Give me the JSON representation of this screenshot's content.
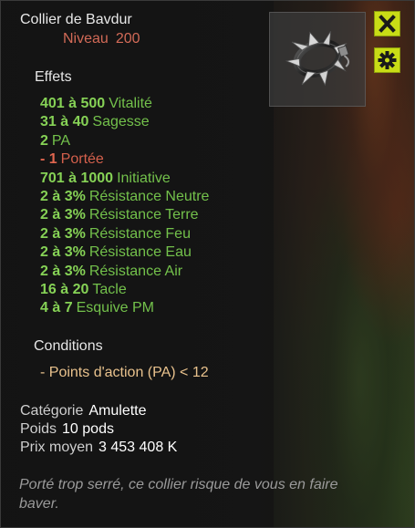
{
  "item": {
    "name": "Collier de Bavdur",
    "level_label": "Niveau",
    "level_value": "200",
    "image_icon": "spiked-collar-icon"
  },
  "buttons": {
    "close_icon": "close-icon",
    "settings_icon": "gear-icon",
    "accent_color": "#c9dc16"
  },
  "effects": {
    "heading": "Effets",
    "items": [
      {
        "value": "401 à 500",
        "name": "Vitalité",
        "negative": false
      },
      {
        "value": "31 à 40",
        "name": "Sagesse",
        "negative": false
      },
      {
        "value": "2",
        "name": "PA",
        "negative": false
      },
      {
        "value": "- 1",
        "name": "Portée",
        "negative": true
      },
      {
        "value": "701 à 1000",
        "name": "Initiative",
        "negative": false
      },
      {
        "value": "2 à 3%",
        "name": "Résistance Neutre",
        "negative": false
      },
      {
        "value": "2 à 3%",
        "name": "Résistance Terre",
        "negative": false
      },
      {
        "value": "2 à 3%",
        "name": "Résistance Feu",
        "negative": false
      },
      {
        "value": "2 à 3%",
        "name": "Résistance Eau",
        "negative": false
      },
      {
        "value": "2 à 3%",
        "name": "Résistance Air",
        "negative": false
      },
      {
        "value": "16 à 20",
        "name": "Tacle",
        "negative": false
      },
      {
        "value": "4 à 7",
        "name": "Esquive PM",
        "negative": false
      }
    ],
    "colors": {
      "bonus": "#73c14b",
      "malus": "#d4604c"
    }
  },
  "conditions": {
    "heading": "Conditions",
    "items": [
      "- Points d'action (PA) < 12"
    ]
  },
  "info": {
    "category_label": "Catégorie",
    "category_value": "Amulette",
    "weight_label": "Poids",
    "weight_value": "10 pods",
    "price_label": "Prix moyen",
    "price_value": "3 453 408 K"
  },
  "description": "Porté trop serré, ce collier risque de vous en faire baver."
}
